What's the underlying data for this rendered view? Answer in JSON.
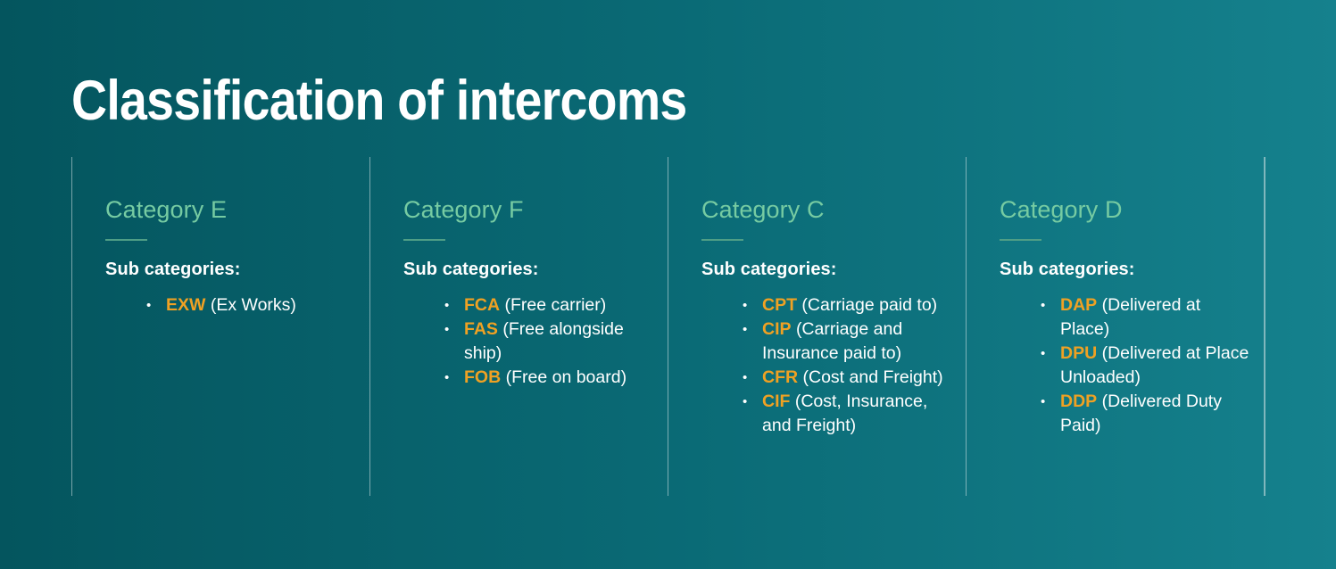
{
  "slide": {
    "title": "Classification of intercoms",
    "theme": {
      "background_left": "#04555e",
      "background_right": "#15818d",
      "heading_color": "#76cba2",
      "code_color": "#efa123",
      "text_color": "#ffffff",
      "rule_color": "#4f9e86",
      "divider_color": "#d8e6e8"
    }
  },
  "columns": [
    {
      "heading": "Category E",
      "sub_label": "Sub categories:",
      "items": [
        {
          "code": "EXW",
          "desc": "(Ex Works)"
        }
      ]
    },
    {
      "heading": "Category F",
      "sub_label": "Sub categories:",
      "items": [
        {
          "code": "FCA",
          "desc": "(Free carrier)"
        },
        {
          "code": "FAS",
          "desc": "(Free alongside ship)"
        },
        {
          "code": "FOB",
          "desc": "(Free on board)"
        }
      ]
    },
    {
      "heading": "Category C",
      "sub_label": "Sub categories:",
      "items": [
        {
          "code": "CPT",
          "desc": "(Carriage paid to)"
        },
        {
          "code": "CIP",
          "desc": "(Carriage and Insurance paid to)"
        },
        {
          "code": "CFR",
          "desc": "(Cost and Freight)"
        },
        {
          "code": "CIF",
          "desc": "(Cost, Insurance, and Freight)"
        }
      ]
    },
    {
      "heading": "Category D",
      "sub_label": "Sub categories:",
      "items": [
        {
          "code": "DAP",
          "desc": "(Delivered at Place)"
        },
        {
          "code": "DPU",
          "desc": "(Delivered at Place Unloaded)"
        },
        {
          "code": "DDP",
          "desc": "(Delivered Duty Paid)"
        }
      ]
    }
  ]
}
